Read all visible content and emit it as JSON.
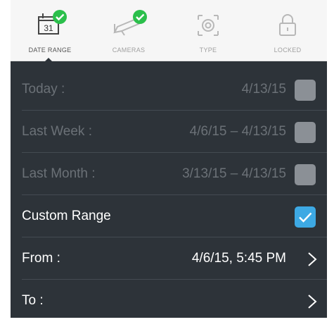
{
  "tabs": [
    {
      "label": "DATE RANGE",
      "icon": "calendar-icon",
      "day": "31",
      "checked": true,
      "active": true
    },
    {
      "label": "CAMERAS",
      "icon": "camera-icon",
      "checked": true,
      "active": false
    },
    {
      "label": "TYPE",
      "icon": "motion-type-icon",
      "checked": false,
      "active": false
    },
    {
      "label": "LOCKED",
      "icon": "lock-icon",
      "checked": false,
      "active": false
    }
  ],
  "rows": {
    "today": {
      "label": "Today :",
      "value": "4/13/15",
      "checked": false
    },
    "last_week": {
      "label": "Last Week :",
      "value": "4/6/15 – 4/13/15",
      "checked": false
    },
    "last_month": {
      "label": "Last Month :",
      "value": "3/13/15 – 4/13/15",
      "checked": false
    },
    "custom": {
      "label": "Custom Range",
      "checked": true
    },
    "from": {
      "label": "From :",
      "value": "4/6/15, 5:45 PM"
    },
    "to": {
      "label": "To :"
    }
  },
  "colors": {
    "panel_bg": "#2d3339",
    "accent": "#3da9e4",
    "check_badge": "#2bbf4b",
    "dim_text": "#6b7177",
    "tab_bar_bg": "#f6f6f6"
  }
}
